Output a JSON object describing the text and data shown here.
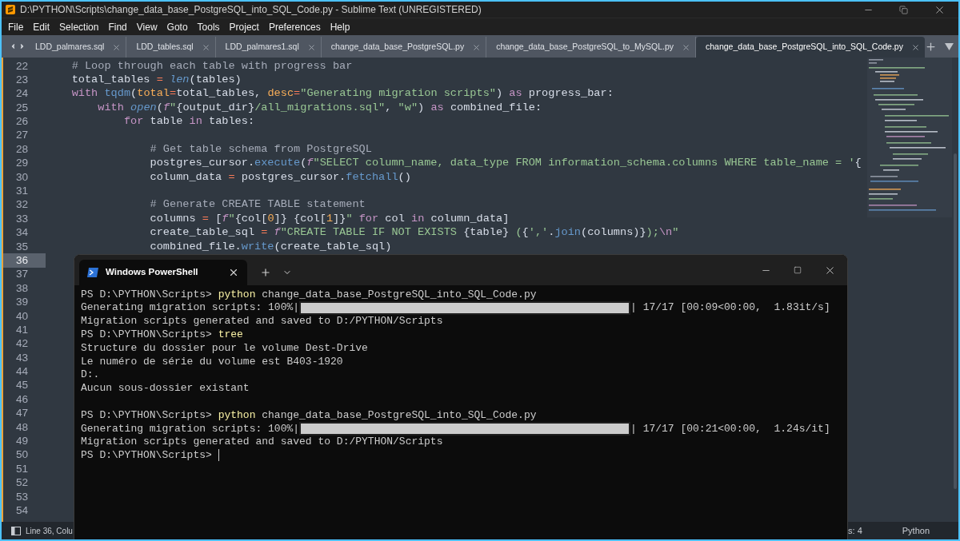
{
  "window": {
    "title": "D:\\PYTHON\\Scripts\\change_data_base_PostgreSQL_into_SQL_Code.py - Sublime Text (UNREGISTERED)"
  },
  "menu": [
    "File",
    "Edit",
    "Selection",
    "Find",
    "View",
    "Goto",
    "Tools",
    "Project",
    "Preferences",
    "Help"
  ],
  "tabs": [
    {
      "label": "LDD_palmares.sql",
      "selected": false
    },
    {
      "label": "LDD_tables.sql",
      "selected": false
    },
    {
      "label": "LDD_palmares1.sql",
      "selected": false
    },
    {
      "label": "change_data_base_PostgreSQL.py",
      "selected": false
    },
    {
      "label": "change_data_base_PostgreSQL_to_MySQL.py",
      "selected": false
    },
    {
      "label": "change_data_base_PostgreSQL_into_SQL_Code.py",
      "selected": true
    }
  ],
  "editor": {
    "lines": [
      {
        "number": "22",
        "current": false,
        "tokens": [
          {
            "kind": "comment",
            "text": "    # Loop through each table with progress bar"
          }
        ]
      },
      {
        "number": "23",
        "current": false,
        "tokens": [
          {
            "kind": "plain",
            "text": "    total_tables "
          },
          {
            "kind": "operator",
            "text": "="
          },
          {
            "kind": "builtin",
            "text": " len"
          },
          {
            "kind": "plain",
            "text": "(tables)"
          }
        ]
      },
      {
        "number": "24",
        "current": false,
        "tokens": [
          {
            "kind": "keyword",
            "text": "    with"
          },
          {
            "kind": "function",
            "text": " tqdm"
          },
          {
            "kind": "plain",
            "text": "("
          },
          {
            "kind": "param",
            "text": "total"
          },
          {
            "kind": "operator",
            "text": "="
          },
          {
            "kind": "plain",
            "text": "total_tables, "
          },
          {
            "kind": "param",
            "text": "desc"
          },
          {
            "kind": "operator",
            "text": "="
          },
          {
            "kind": "string",
            "text": "\"Generating migration scripts\""
          },
          {
            "kind": "plain",
            "text": ") "
          },
          {
            "kind": "keyword",
            "text": "as"
          },
          {
            "kind": "plain",
            "text": " progress_bar:"
          }
        ]
      },
      {
        "number": "25",
        "current": false,
        "tokens": [
          {
            "kind": "keyword",
            "text": "        with"
          },
          {
            "kind": "builtin",
            "text": " open"
          },
          {
            "kind": "plain",
            "text": "("
          },
          {
            "kind": "prefix",
            "text": "f"
          },
          {
            "kind": "string",
            "text": "\""
          },
          {
            "kind": "plain",
            "text": "{output_dir}"
          },
          {
            "kind": "string",
            "text": "/all_migrations.sql\""
          },
          {
            "kind": "plain",
            "text": ", "
          },
          {
            "kind": "string",
            "text": "\"w\""
          },
          {
            "kind": "plain",
            "text": ") "
          },
          {
            "kind": "keyword",
            "text": "as"
          },
          {
            "kind": "plain",
            "text": " combined_file:"
          }
        ]
      },
      {
        "number": "26",
        "current": false,
        "tokens": [
          {
            "kind": "keyword",
            "text": "            for"
          },
          {
            "kind": "plain",
            "text": " table "
          },
          {
            "kind": "keyword",
            "text": "in"
          },
          {
            "kind": "plain",
            "text": " tables:"
          }
        ]
      },
      {
        "number": "27",
        "current": false
      },
      {
        "number": "28",
        "current": false,
        "tokens": [
          {
            "kind": "comment",
            "text": "                # Get table schema from PostgreSQL"
          }
        ]
      },
      {
        "number": "29",
        "current": false,
        "tokens": [
          {
            "kind": "plain",
            "text": "                postgres_cursor."
          },
          {
            "kind": "function",
            "text": "execute"
          },
          {
            "kind": "plain",
            "text": "("
          },
          {
            "kind": "prefix",
            "text": "f"
          },
          {
            "kind": "string",
            "text": "\"SELECT column_name, data_type FROM information_schema.columns WHERE table_name = '"
          },
          {
            "kind": "plain",
            "text": "{"
          }
        ]
      },
      {
        "number": "30",
        "current": false,
        "tokens": [
          {
            "kind": "plain",
            "text": "                column_data "
          },
          {
            "kind": "operator",
            "text": "="
          },
          {
            "kind": "plain",
            "text": " postgres_cursor."
          },
          {
            "kind": "function",
            "text": "fetchall"
          },
          {
            "kind": "plain",
            "text": "()"
          }
        ]
      },
      {
        "number": "31",
        "current": false
      },
      {
        "number": "32",
        "current": false,
        "tokens": [
          {
            "kind": "comment",
            "text": "                # Generate CREATE TABLE statement"
          }
        ]
      },
      {
        "number": "33",
        "current": false,
        "tokens": [
          {
            "kind": "plain",
            "text": "                columns "
          },
          {
            "kind": "operator",
            "text": "="
          },
          {
            "kind": "plain",
            "text": " ["
          },
          {
            "kind": "prefix",
            "text": "f"
          },
          {
            "kind": "string",
            "text": "\""
          },
          {
            "kind": "plain",
            "text": "{col["
          },
          {
            "kind": "number",
            "text": "0"
          },
          {
            "kind": "plain",
            "text": "]} {col["
          },
          {
            "kind": "number",
            "text": "1"
          },
          {
            "kind": "plain",
            "text": "]}"
          },
          {
            "kind": "string",
            "text": "\""
          },
          {
            "kind": "keyword",
            "text": " for"
          },
          {
            "kind": "plain",
            "text": " col "
          },
          {
            "kind": "keyword",
            "text": "in"
          },
          {
            "kind": "plain",
            "text": " column_data]"
          }
        ]
      },
      {
        "number": "34",
        "current": false,
        "tokens": [
          {
            "kind": "plain",
            "text": "                create_table_sql "
          },
          {
            "kind": "operator",
            "text": "="
          },
          {
            "kind": "prefix",
            "text": " f"
          },
          {
            "kind": "string",
            "text": "\"CREATE TABLE IF NOT EXISTS "
          },
          {
            "kind": "plain",
            "text": "{table}"
          },
          {
            "kind": "string",
            "text": " ("
          },
          {
            "kind": "plain",
            "text": "{"
          },
          {
            "kind": "string",
            "text": "','"
          },
          {
            "kind": "plain",
            "text": "."
          },
          {
            "kind": "function",
            "text": "join"
          },
          {
            "kind": "plain",
            "text": "(columns)}"
          },
          {
            "kind": "string",
            "text": ");"
          },
          {
            "kind": "escape",
            "text": "\\n"
          },
          {
            "kind": "string",
            "text": "\""
          }
        ]
      },
      {
        "number": "35",
        "current": false,
        "tokens": [
          {
            "kind": "plain",
            "text": "                combined_file."
          },
          {
            "kind": "function",
            "text": "write"
          },
          {
            "kind": "plain",
            "text": "(create_table_sql)"
          }
        ]
      },
      {
        "number": "36",
        "current": true
      },
      {
        "number": "37",
        "current": false
      },
      {
        "number": "38",
        "current": false
      },
      {
        "number": "39",
        "current": false
      },
      {
        "number": "40",
        "current": false
      },
      {
        "number": "41",
        "current": false
      },
      {
        "number": "42",
        "current": false
      },
      {
        "number": "43",
        "current": false
      },
      {
        "number": "44",
        "current": false
      },
      {
        "number": "45",
        "current": false
      },
      {
        "number": "46",
        "current": false
      },
      {
        "number": "47",
        "current": false
      },
      {
        "number": "48",
        "current": false
      },
      {
        "number": "49",
        "current": false
      },
      {
        "number": "50",
        "current": false
      },
      {
        "number": "51",
        "current": false
      },
      {
        "number": "52",
        "current": false
      },
      {
        "number": "53",
        "current": false
      },
      {
        "number": "54",
        "current": false
      }
    ]
  },
  "status_bar": {
    "position": "Line 36, Colu",
    "indentation": "s: 4",
    "syntax": "Python"
  },
  "terminal": {
    "tab": "Windows PowerShell",
    "lines": [
      {
        "kind": "prompt",
        "prompt": "PS D:\\PYTHON\\Scripts>",
        "command": "python",
        "args": "change_data_base_PostgreSQL_into_SQL_Code.py",
        "cursor": false
      },
      {
        "kind": "progress",
        "label": "Generating migration scripts: 100%|",
        "level": 1,
        "stats": "| 17/17 [00:09<00:00,  1.83it/s]"
      },
      {
        "kind": "output",
        "text": "Migration scripts generated and saved to D:/PYTHON/Scripts"
      },
      {
        "kind": "prompt",
        "prompt": "PS D:\\PYTHON\\Scripts>",
        "command": "tree",
        "cursor": false
      },
      {
        "kind": "output",
        "text": "Structure du dossier pour le volume Dest-Drive"
      },
      {
        "kind": "output",
        "text": "Le numéro de série du volume est B403-1920"
      },
      {
        "kind": "output",
        "text": "D:."
      },
      {
        "kind": "output",
        "text": "Aucun sous-dossier existant"
      },
      {
        "kind": "blank"
      },
      {
        "kind": "prompt",
        "prompt": "PS D:\\PYTHON\\Scripts>",
        "command": "python",
        "args": "change_data_base_PostgreSQL_into_SQL_Code.py",
        "cursor": false
      },
      {
        "kind": "progress",
        "label": "Generating migration scripts: 100%|",
        "level": 1,
        "stats": "| 17/17 [00:21<00:00,  1.24s/it]"
      },
      {
        "kind": "output",
        "text": "Migration scripts generated and saved to D:/PYTHON/Scripts"
      },
      {
        "kind": "prompt",
        "prompt": "PS D:\\PYTHON\\Scripts>",
        "cursor": true
      }
    ]
  }
}
